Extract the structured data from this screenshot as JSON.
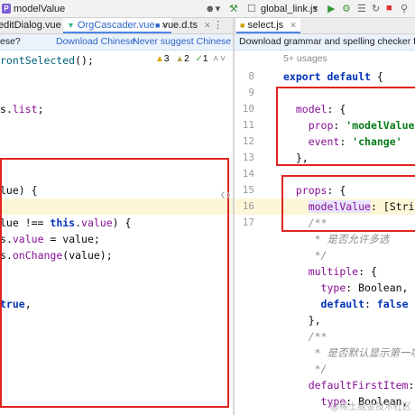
{
  "title_bar": {
    "file_badge": "P",
    "file_title": "modelValue",
    "run_config": "global_link.js"
  },
  "left_tabs": [
    "editDialog.vue",
    "OrgCascader.vue",
    "vue.d.ts"
  ],
  "right_tabs": [
    "select.js"
  ],
  "left_notification": {
    "text": "ese?",
    "download": "Download Chinese",
    "never": "Never suggest Chinese"
  },
  "right_notification": {
    "text": "Download grammar and spelling checker for Chine"
  },
  "left_inspections": {
    "warnings": "3",
    "weak": "2",
    "typos": "1"
  },
  "left_code": [
    "rontSelected();",
    "",
    "",
    "s.list;",
    "",
    "",
    "",
    "",
    "lue) {",
    "",
    "lue !== this.value) {",
    "s.value = value;",
    "s.onChange(value);",
    "",
    "",
    "true,",
    "",
    "",
    "",
    "",
    ""
  ],
  "right_code": {
    "usages": "5+ usages",
    "lines": [
      {
        "n": "8",
        "t": "export default {"
      },
      {
        "n": "9",
        "t": ""
      },
      {
        "n": "10",
        "t": "  model: {"
      },
      {
        "n": "11",
        "t": "    prop: 'modelValue',"
      },
      {
        "n": "12",
        "t": "    event: 'change'"
      },
      {
        "n": "13",
        "t": "  },"
      },
      {
        "n": "14",
        "t": ""
      },
      {
        "n": "15",
        "t": "  props: {"
      },
      {
        "n": "16",
        "t": "    modelValue: [String,"
      },
      {
        "n": "17",
        "t": "    /**"
      },
      {
        "n": "",
        "t": "     * 是否允许多选"
      },
      {
        "n": "",
        "t": "     */"
      },
      {
        "n": "",
        "t": "    multiple: {"
      },
      {
        "n": "",
        "t": "      type: Boolean,"
      },
      {
        "n": "",
        "t": "      default: false"
      },
      {
        "n": "",
        "t": "    },"
      },
      {
        "n": "",
        "t": "    /**"
      },
      {
        "n": "",
        "t": "     * 是否默认显示第一项"
      },
      {
        "n": "",
        "t": "     */"
      },
      {
        "n": "",
        "t": "    defaultFirstItem: {"
      },
      {
        "n": "",
        "t": "      type: Boolean,"
      }
    ]
  },
  "watermark": "@稀土掘金技术社区",
  "colors": {
    "annotation_box": "#e0241f",
    "current_line": "#fdf7d7",
    "keyword": "#0033b3",
    "string": "#067d17",
    "property": "#871094"
  }
}
